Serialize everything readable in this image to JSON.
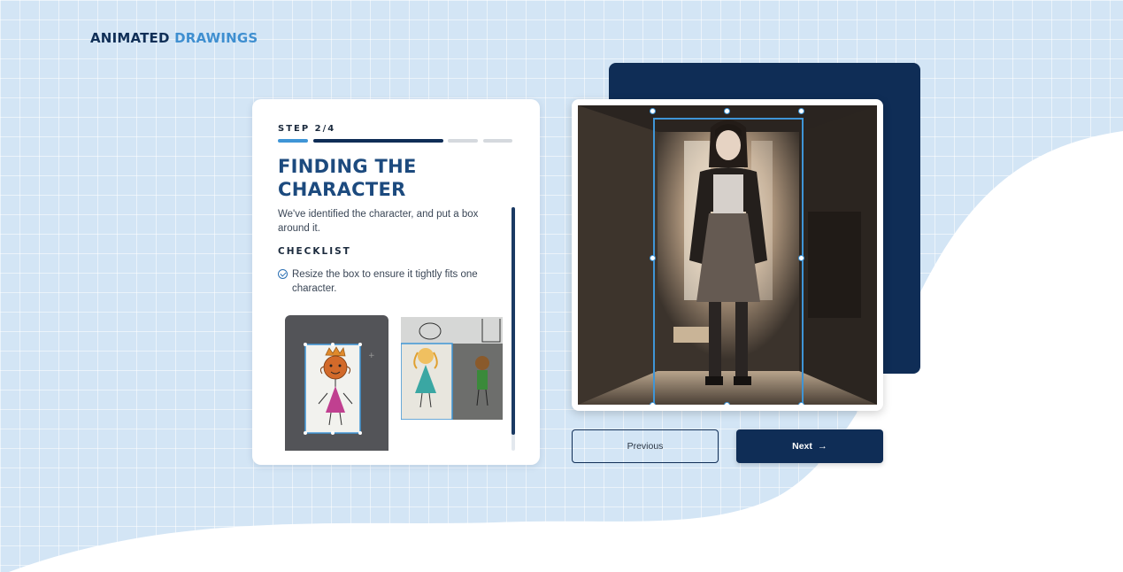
{
  "brand": {
    "part1": "ANIMATED",
    "part2": "DRAWINGS"
  },
  "step": {
    "label": "STEP 2/4",
    "progress": {
      "current": 2,
      "total": 4
    },
    "title": "FINDING THE CHARACTER",
    "description": "We've identified the character, and put a box around it.",
    "checklist_heading": "CHECKLIST",
    "checklist": [
      {
        "text": "Resize the box to ensure it tightly fits one character."
      }
    ],
    "examples": [
      {
        "name": "example-crowned-figure"
      },
      {
        "name": "example-multiple-characters"
      }
    ]
  },
  "buttons": {
    "previous": "Previous",
    "next": "Next",
    "next_icon": "arrow-right-icon"
  },
  "colors": {
    "navy": "#0f2d56",
    "accent": "#3f95d6",
    "background": "#d3e5f5"
  }
}
